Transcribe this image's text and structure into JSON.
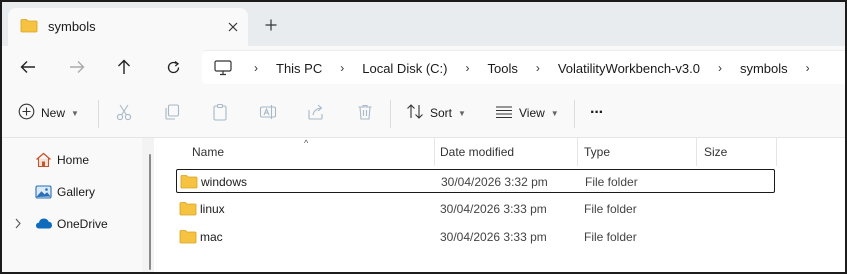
{
  "tab": {
    "title": "symbols",
    "close": "✕",
    "new": "+"
  },
  "breadcrumb": [
    "This PC",
    "Local Disk (C:)",
    "Tools",
    "VolatilityWorkbench-v3.0",
    "symbols"
  ],
  "breadcrumb_sep": "›",
  "toolbar": {
    "new_label": "New",
    "sort_label": "Sort",
    "view_label": "View",
    "more_label": "···"
  },
  "sidebar": {
    "items": [
      {
        "label": "Home",
        "icon": "home-icon"
      },
      {
        "label": "Gallery",
        "icon": "gallery-icon"
      },
      {
        "label": "OneDrive",
        "icon": "cloud-icon",
        "expandable": true
      }
    ]
  },
  "columns": {
    "name": "Name",
    "date": "Date modified",
    "type": "Type",
    "size": "Size"
  },
  "files": [
    {
      "name": "windows",
      "date": "30/04/2026 3:32 pm",
      "type": "File folder",
      "selected": true
    },
    {
      "name": "linux",
      "date": "30/04/2026 3:33 pm",
      "type": "File folder",
      "selected": false
    },
    {
      "name": "mac",
      "date": "30/04/2026 3:33 pm",
      "type": "File folder",
      "selected": false
    }
  ],
  "colors": {
    "folder": "#f5c242",
    "accent": "#0067c0",
    "onedrive": "#0f6cbd"
  }
}
